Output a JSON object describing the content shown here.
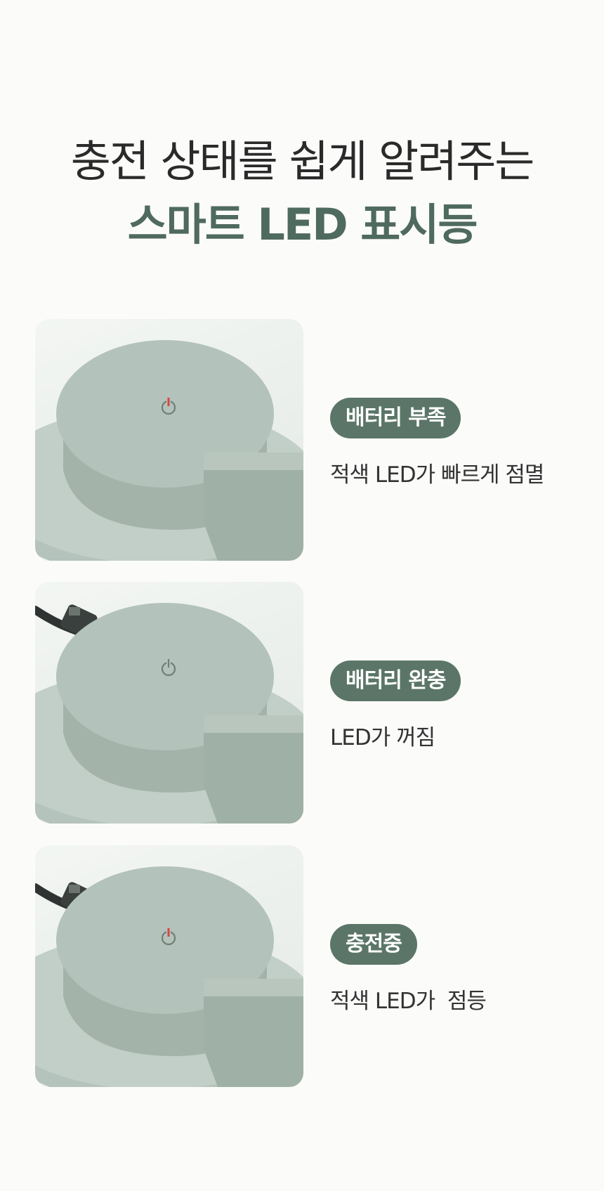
{
  "heading": {
    "line1": "충전 상태를 쉽게 알려주는",
    "line2": "스마트 LED 표시등"
  },
  "colors": {
    "accent": "#5b7668",
    "product": "#a9b8b0",
    "led_red": "#d9463f"
  },
  "states": [
    {
      "badge": "배터리 부족",
      "description": "적색 LED가 빠르게 점멸",
      "led": "red",
      "cable": false
    },
    {
      "badge": "배터리 완충",
      "description": "LED가 꺼짐",
      "led": "off",
      "cable": true
    },
    {
      "badge": "충전중",
      "description": "적색 LED가  점등",
      "led": "red",
      "cable": true
    }
  ]
}
